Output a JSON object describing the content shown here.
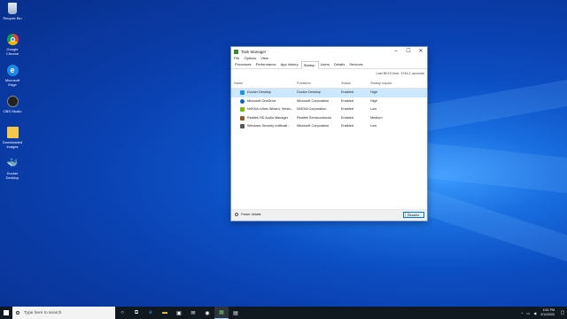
{
  "desktop": {
    "icons": [
      {
        "label": "Recycle Bin",
        "icon": "recycle-bin-icon"
      },
      {
        "label": "Google Chrome",
        "icon": "chrome-icon"
      },
      {
        "label": "Microsoft Edge",
        "icon": "edge-icon"
      },
      {
        "label": "OBS Studio",
        "icon": "obs-icon"
      },
      {
        "label": "Downloaded Images",
        "icon": "folder-icon"
      },
      {
        "label": "Docker Desktop",
        "icon": "docker-icon"
      }
    ]
  },
  "window": {
    "title": "Task Manager",
    "menu": [
      "File",
      "Options",
      "View"
    ],
    "tabs": [
      "Processes",
      "Performance",
      "App history",
      "Startup",
      "Users",
      "Details",
      "Services"
    ],
    "active_tab": "Startup",
    "bios_time": "Last BIOS time:  3746.1 seconds",
    "columns": {
      "name": "Name",
      "publisher": "Publisher",
      "status": "Status",
      "impact": "Startup impact"
    },
    "rows": [
      {
        "name": "Docker Desktop",
        "publisher": "Docker Desktop",
        "status": "Enabled",
        "impact": "High",
        "icon": "docker-icon",
        "color": "#1d91e6"
      },
      {
        "name": "Microsoft OneDrive",
        "publisher": "Microsoft Corporation",
        "status": "Enabled",
        "impact": "High",
        "icon": "onedrive-icon",
        "color": "#0a64c8"
      },
      {
        "name": "NVIDIA nView Wizard, Versio...",
        "publisher": "NVIDIA Corporation",
        "status": "Enabled",
        "impact": "Low",
        "icon": "nvidia-icon",
        "color": "#76b900"
      },
      {
        "name": "Realtek HD Audio Manager",
        "publisher": "Realtek Semiconductor",
        "status": "Enabled",
        "impact": "Medium",
        "icon": "speaker-icon",
        "color": "#8a5a2a"
      },
      {
        "name": "Windows Security notificati...",
        "publisher": "Microsoft Corporation",
        "status": "Enabled",
        "impact": "Low",
        "icon": "shield-icon",
        "color": "#555555"
      }
    ],
    "fewer_details": "Fewer details",
    "disable_label": "Disable"
  },
  "taskbar": {
    "search_placeholder": "Type here to search",
    "time": "4:51 PM",
    "date": "2/11/2020"
  }
}
